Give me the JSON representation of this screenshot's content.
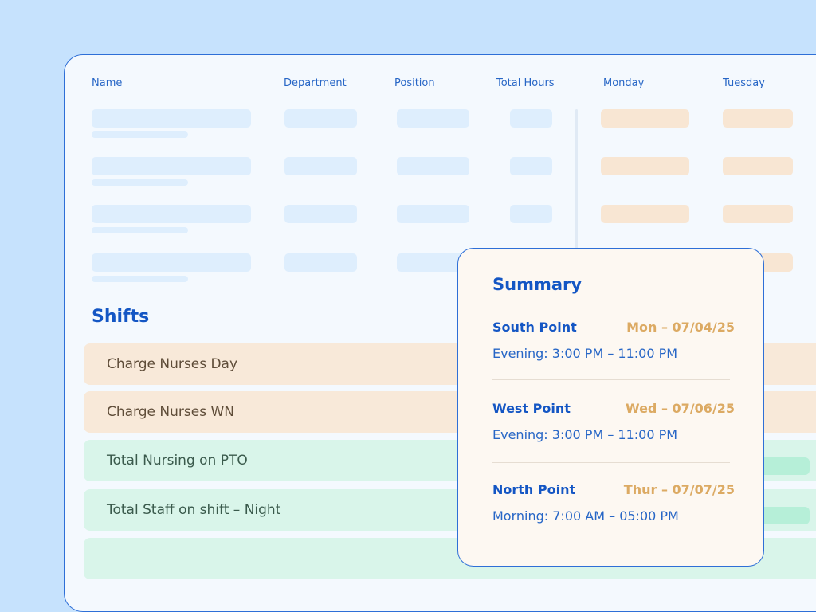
{
  "table": {
    "headers": [
      {
        "key": "name",
        "label": "Name"
      },
      {
        "key": "department",
        "label": "Department"
      },
      {
        "key": "position",
        "label": "Position"
      },
      {
        "key": "total_hours",
        "label": "Total Hours"
      },
      {
        "key": "monday",
        "label": "Monday"
      },
      {
        "key": "tuesday",
        "label": "Tuesday"
      }
    ]
  },
  "shifts": {
    "title": "Shifts",
    "rows": [
      {
        "label": "Charge Nurses Day",
        "tone": "orange"
      },
      {
        "label": "Charge Nurses WN",
        "tone": "orange"
      },
      {
        "label": "Total Nursing on PTO",
        "tone": "green"
      },
      {
        "label": "Total Staff on shift – Night",
        "tone": "green"
      }
    ]
  },
  "summary": {
    "title": "Summary",
    "entries": [
      {
        "location": "South Point",
        "date": "Mon – 07/04/25",
        "time": "Evening: 3:00 PM  – 11:00 PM"
      },
      {
        "location": "West Point",
        "date": "Wed – 07/06/25",
        "time": "Evening: 3:00 PM  – 11:00 PM"
      },
      {
        "location": "North Point",
        "date": "Thur – 07/07/25",
        "time": "Morning: 7:00 AM  – 05:00 PM"
      }
    ]
  },
  "colors": {
    "accent": "#1456c4",
    "border": "#2e6fd7",
    "page_bg": "#c6e2fd",
    "date_accent": "#dcaa63",
    "shift_orange": "#f8e9d9",
    "shift_green": "#d9f5ea"
  }
}
